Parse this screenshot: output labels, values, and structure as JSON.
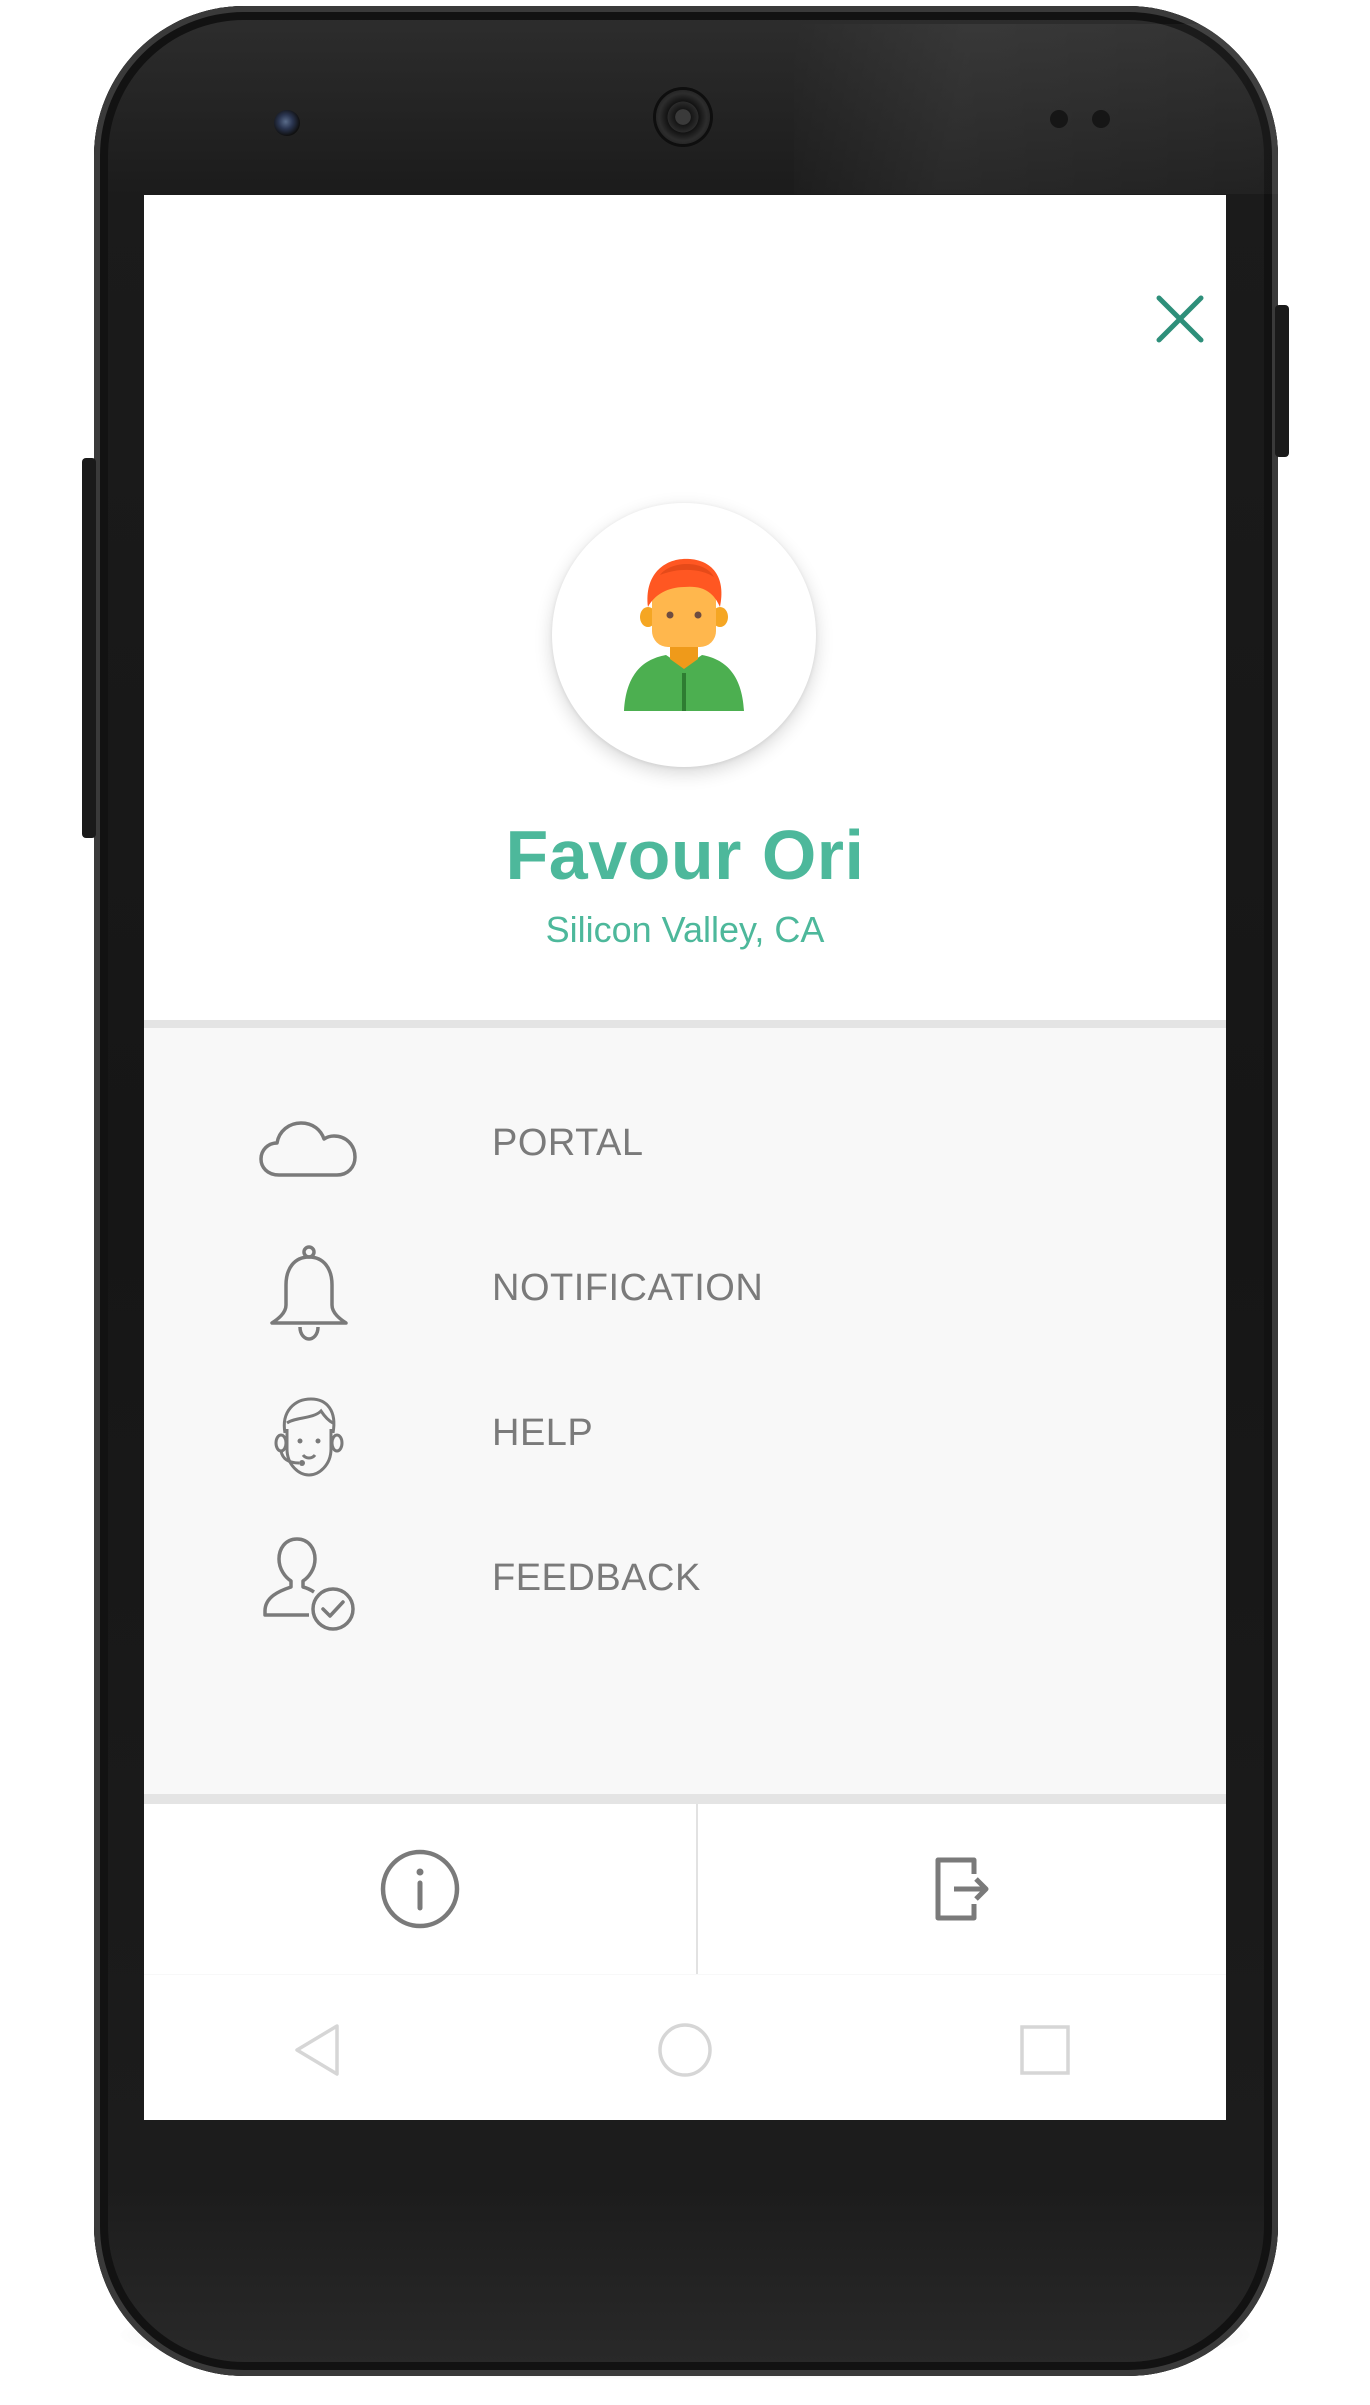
{
  "profile": {
    "name": "Favour Ori",
    "location": "Silicon Valley, CA",
    "avatar_icon": "person-avatar-icon"
  },
  "header": {
    "close_icon": "close-icon"
  },
  "menu": {
    "items": [
      {
        "label": "PORTAL",
        "icon": "cloud-icon"
      },
      {
        "label": "NOTIFICATION",
        "icon": "bell-icon"
      },
      {
        "label": "HELP",
        "icon": "support-agent-icon"
      },
      {
        "label": "FEEDBACK",
        "icon": "user-check-icon"
      }
    ]
  },
  "bottom_bar": {
    "info_icon": "info-icon",
    "logout_icon": "logout-icon"
  },
  "nav_bar": {
    "back_icon": "back-triangle-icon",
    "home_icon": "home-circle-icon",
    "recents_icon": "recents-square-icon"
  },
  "colors": {
    "accent": "#4db89b",
    "icon_gray": "#7a7a7a",
    "menu_background": "#f8f8f8",
    "divider": "#e4e4e4"
  }
}
